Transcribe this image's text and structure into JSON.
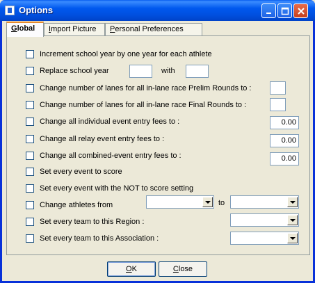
{
  "window": {
    "title": "Options"
  },
  "tabs": [
    {
      "mnemonic": "G",
      "rest": "lobal"
    },
    {
      "mnemonic": "I",
      "rest": "mport Picture"
    },
    {
      "mnemonic": "P",
      "rest": "ersonal Preferences"
    }
  ],
  "options": {
    "increment_year": "Increment school year by one year for each athlete",
    "replace_year": "Replace school year",
    "replace_with": "with",
    "prelim_lanes": "Change number of lanes for all in-lane race Prelim Rounds to :",
    "final_lanes": "Change number of lanes for all in-lane race Final Rounds to :",
    "individual_fees": "Change all individual event entry fees to :",
    "individual_fee_value": "0.00",
    "relay_fees": "Change all relay event entry fees to :",
    "relay_fee_value": "0.00",
    "combined_fees": "Change all combined-event entry fees to :",
    "combined_fee_value": "0.00",
    "set_score": "Set every event to score",
    "set_not_score": "Set every event with the NOT to score setting",
    "change_athletes": "Change athletes from",
    "change_athletes_to": "to",
    "team_region": "Set every team to this Region :",
    "team_association": "Set every team to this Association :"
  },
  "buttons": {
    "ok_mnemonic": "O",
    "ok_rest": "K",
    "close_mnemonic": "C",
    "close_rest": "lose"
  },
  "colors": {
    "titlebar": "#0058EE",
    "face": "#ECE9D8",
    "tab_highlight": "#E68B2C"
  }
}
